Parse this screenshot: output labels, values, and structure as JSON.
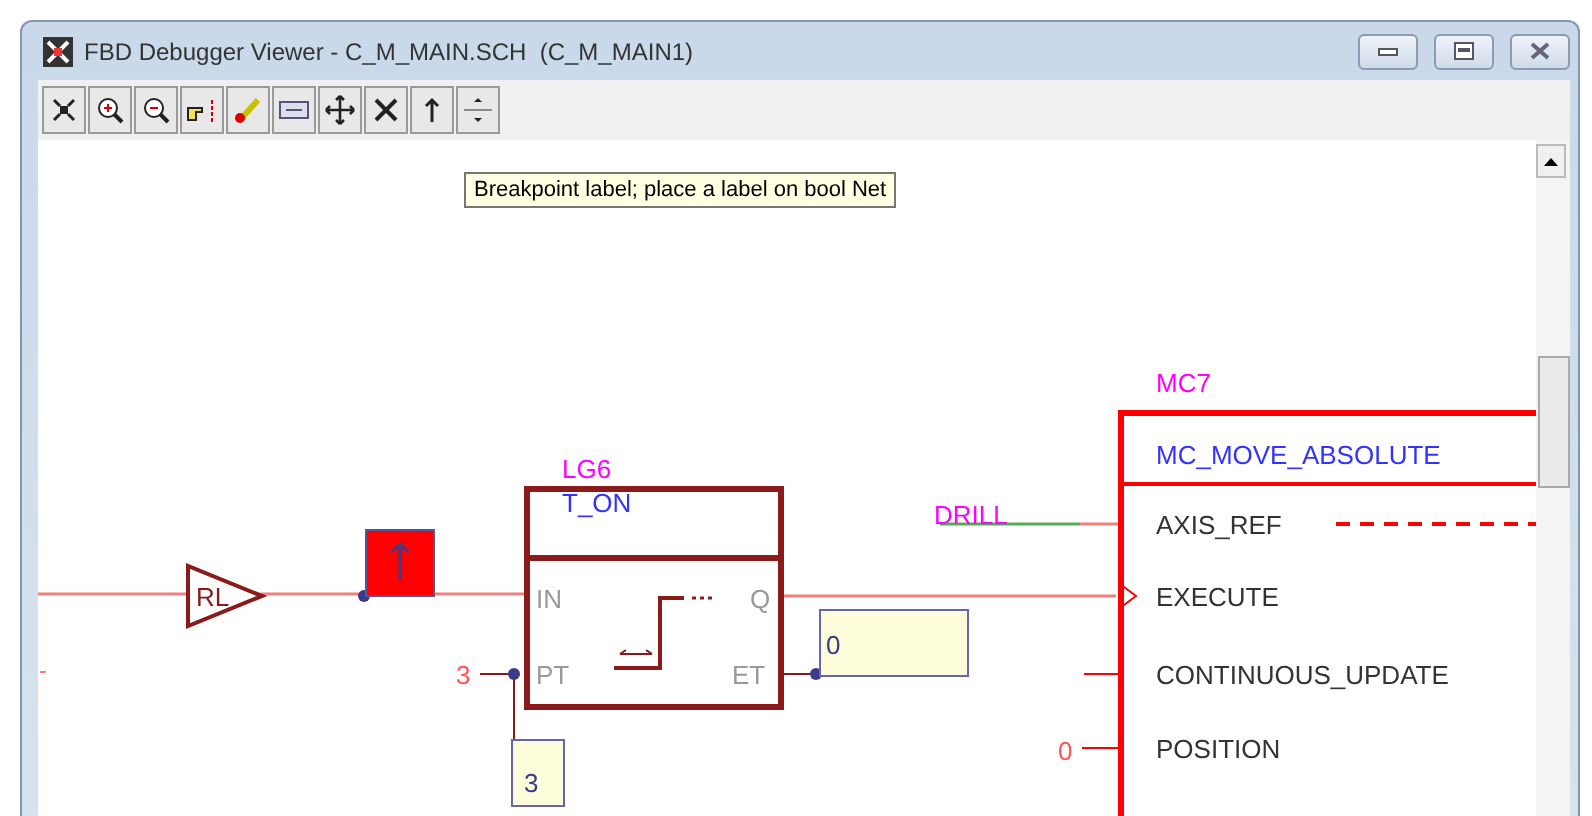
{
  "window": {
    "title": "FBD Debugger Viewer - C_M_MAIN.SCH  (C_M_MAIN1)"
  },
  "tooltip": {
    "text": "Breakpoint label; place a label on bool Net"
  },
  "diagram": {
    "rl_gate": {
      "label": "RL"
    },
    "timer_block": {
      "instance": "LG6",
      "type": "T_ON",
      "inputs": [
        "IN",
        "PT"
      ],
      "outputs": [
        "Q",
        "ET"
      ],
      "pt_constant": "3",
      "pt_value": "3",
      "et_value": "0"
    },
    "motion_block": {
      "instance": "MC7",
      "type": "MC_MOVE_ABSOLUTE",
      "axis_variable": "DRILL",
      "position_constant": "0",
      "pins": [
        "AXIS_REF",
        "EXECUTE",
        "CONTINUOUS_UPDATE",
        "POSITION"
      ]
    }
  }
}
